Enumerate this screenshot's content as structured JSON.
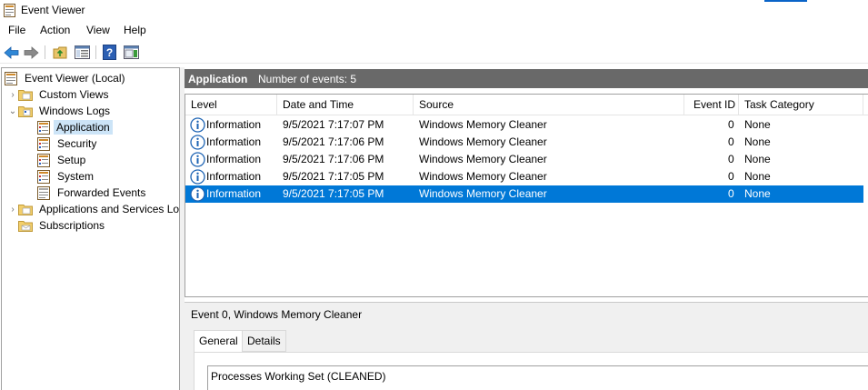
{
  "window": {
    "title": "Event Viewer"
  },
  "menu": [
    "File",
    "Action",
    "View",
    "Help"
  ],
  "toolbar": {
    "buttons": [
      "back-icon",
      "forward-icon",
      "folder-up-icon",
      "show-hide-tree-icon",
      "help-icon",
      "show-hide-action-pane-icon"
    ]
  },
  "tree": {
    "items": [
      {
        "label": "Event Viewer (Local)",
        "icon": "event-viewer-icon"
      },
      {
        "label": "Custom Views",
        "icon": "folder-icon"
      },
      {
        "label": "Windows Logs",
        "icon": "folder-icon"
      },
      {
        "label": "Application",
        "icon": "log-icon"
      },
      {
        "label": "Security",
        "icon": "log-icon"
      },
      {
        "label": "Setup",
        "icon": "log-icon"
      },
      {
        "label": "System",
        "icon": "log-icon"
      },
      {
        "label": "Forwarded Events",
        "icon": "log-icon"
      },
      {
        "label": "Applications and Services Lo",
        "icon": "folder-icon"
      },
      {
        "label": "Subscriptions",
        "icon": "subscriptions-icon"
      }
    ]
  },
  "log": {
    "name": "Application",
    "event_count": "Number of events: 5"
  },
  "table": {
    "columns": [
      "Level",
      "Date and Time",
      "Source",
      "Event ID",
      "Task Category"
    ],
    "rows": [
      {
        "level": "Information",
        "datetime": "9/5/2021 7:17:07 PM",
        "source": "Windows Memory Cleaner",
        "event_id": "0",
        "task": "None"
      },
      {
        "level": "Information",
        "datetime": "9/5/2021 7:17:06 PM",
        "source": "Windows Memory Cleaner",
        "event_id": "0",
        "task": "None"
      },
      {
        "level": "Information",
        "datetime": "9/5/2021 7:17:06 PM",
        "source": "Windows Memory Cleaner",
        "event_id": "0",
        "task": "None"
      },
      {
        "level": "Information",
        "datetime": "9/5/2021 7:17:05 PM",
        "source": "Windows Memory Cleaner",
        "event_id": "0",
        "task": "None"
      },
      {
        "level": "Information",
        "datetime": "9/5/2021 7:17:05 PM",
        "source": "Windows Memory Cleaner",
        "event_id": "0",
        "task": "None"
      }
    ]
  },
  "details": {
    "title": "Event 0, Windows Memory Cleaner",
    "tabs": [
      "General",
      "Details"
    ],
    "description": "Processes Working Set (CLEANED)"
  },
  "colors": {
    "selection": "#0078d7",
    "tree_selection": "#cce4f7",
    "header_bar": "#696969",
    "info_icon": "#1e64b4"
  }
}
